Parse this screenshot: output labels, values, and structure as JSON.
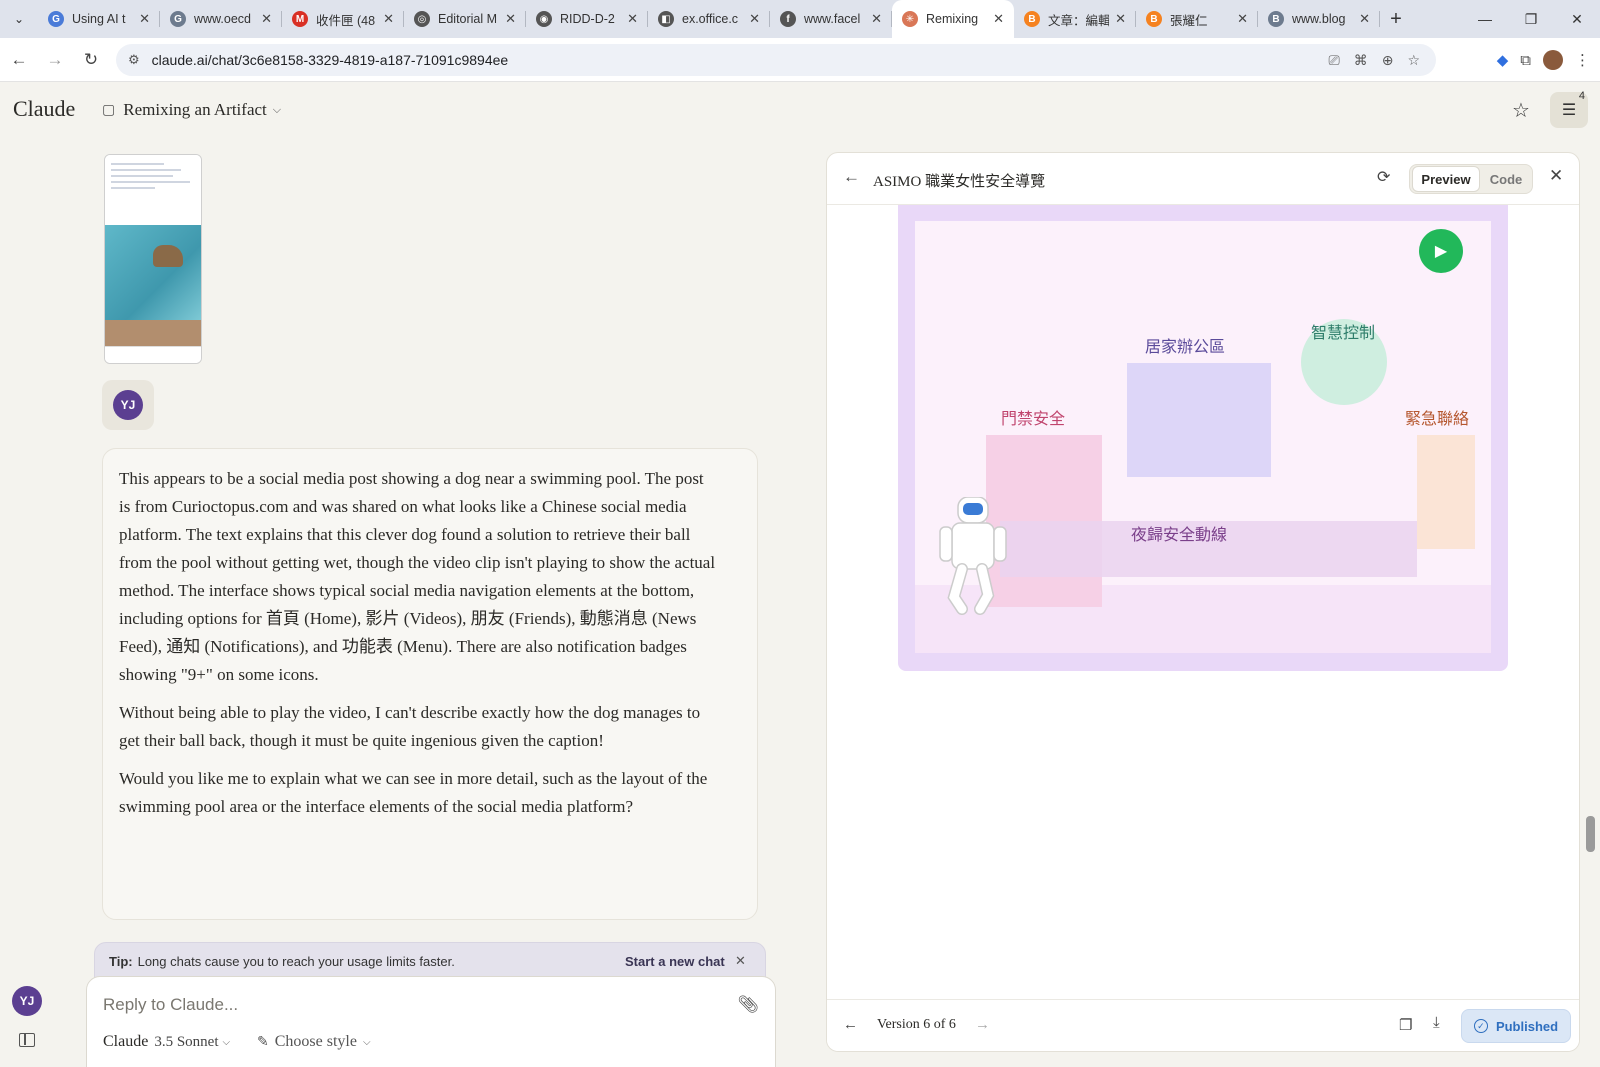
{
  "browser": {
    "tabs": [
      {
        "title": "Using AI t",
        "favicon_color": "#4a7bd8",
        "favicon": "G"
      },
      {
        "title": "www.oecd",
        "favicon_color": "#6d7b8e",
        "favicon": "G"
      },
      {
        "title": "收件匣 (48",
        "favicon_color": "#d93025",
        "favicon": "M"
      },
      {
        "title": "Editorial M",
        "favicon_color": "#555555",
        "favicon": "◎"
      },
      {
        "title": "RIDD-D-2",
        "favicon_color": "#555555",
        "favicon": "◉"
      },
      {
        "title": "ex.office.c",
        "favicon_color": "#555555",
        "favicon": "◧"
      },
      {
        "title": "www.facel",
        "favicon_color": "#555555",
        "favicon": "f"
      },
      {
        "title": "Remixing",
        "favicon_color": "#d97757",
        "favicon": "✳",
        "active": true
      },
      {
        "title": "文章：編輯",
        "favicon_color": "#f58220",
        "favicon": "B"
      },
      {
        "title": "張耀仁",
        "favicon_color": "#f58220",
        "favicon": "B"
      },
      {
        "title": "www.blog",
        "favicon_color": "#6d7b8e",
        "favicon": "B"
      }
    ],
    "url": "claude.ai/chat/3c6e8158-3329-4819-a187-71091c9894ee"
  },
  "app": {
    "logo": "Claude",
    "chat_title": "Remixing an Artifact",
    "notification_count": "4"
  },
  "chat": {
    "user_initials": "YJ",
    "reply_paragraphs": [
      "This appears to be a social media post showing a dog near a swimming pool. The post is from Curioctopus.com and was shared on what looks like a Chinese social media platform. The text explains that this clever dog found a solution to retrieve their ball from the pool without getting wet, though the video clip isn't playing to show the actual method. The interface shows typical social media navigation elements at the bottom, including options for 首頁 (Home), 影片 (Videos), 朋友 (Friends), 動態消息 (News Feed), 通知 (Notifications), and 功能表 (Menu). There are also notification badges showing \"9+\" on some icons.",
      "Without being able to play the video, I can't describe exactly how the dog manages to get their ball back, though it must be quite ingenious given the caption!",
      "Would you like me to explain what we can see in more detail, such as the layout of the swimming pool area or the interface elements of the social media platform?"
    ],
    "tip_label": "Tip:",
    "tip_text": "Long chats cause you to reach your usage limits faster.",
    "tip_action": "Start a new chat",
    "composer_placeholder": "Reply to Claude...",
    "model_name": "Claude",
    "model_version": "3.5 Sonnet",
    "style_label": "Choose style"
  },
  "artifact": {
    "title": "ASIMO 職業女性安全導覽",
    "tab_preview": "Preview",
    "tab_code": "Code",
    "zones": [
      {
        "label": "居家辦公區",
        "color": "#5a4a9a",
        "fill": "#ddd6f8"
      },
      {
        "label": "智慧控制",
        "color": "#2e7d6a",
        "fill": "#cfeee0"
      },
      {
        "label": "門禁安全",
        "color": "#c0446d",
        "fill": "#f6d0e6"
      },
      {
        "label": "緊急聯絡",
        "color": "#b5572f",
        "fill": "#fbe4d6"
      },
      {
        "label": "夜歸安全動線",
        "color": "#7a3f8a",
        "fill": "#ead3ef"
      }
    ],
    "version_text": "Version 6 of 6",
    "published_label": "Published"
  },
  "colors": {
    "accent_green": "#22b85a",
    "published_blue": "#2f6fbf",
    "avatar_purple": "#5b3f91"
  }
}
